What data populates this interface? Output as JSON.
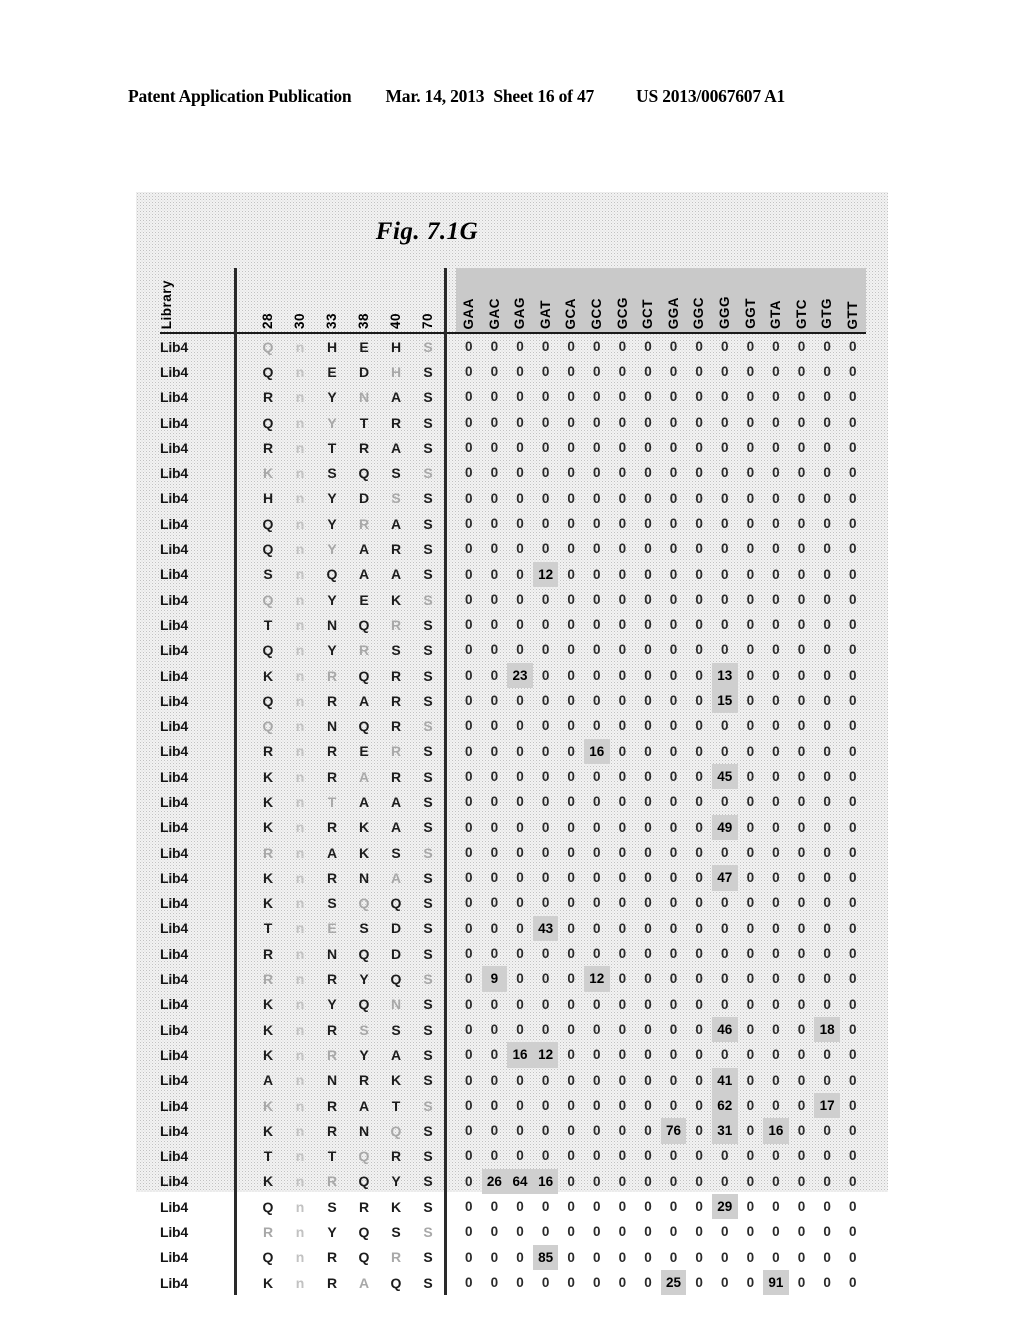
{
  "header": {
    "publication": "Patent Application Publication",
    "date": "Mar. 14, 2013",
    "sheet": "Sheet 16 of 47",
    "patent_number": "US 2013/0067607 A1"
  },
  "figure": {
    "title": "Fig. 7.1G"
  },
  "table": {
    "library_header": "Library",
    "position_headers": [
      "28",
      "30",
      "33",
      "38",
      "40",
      "70"
    ],
    "codon_headers": [
      "GAA",
      "GAC",
      "GAG",
      "GAT",
      "GCA",
      "GCC",
      "GCG",
      "GCT",
      "GGA",
      "GGC",
      "GGG",
      "GGT",
      "GTA",
      "GTC",
      "GTG",
      "GTT"
    ],
    "rows": [
      {
        "library": "Lib4",
        "residues": [
          "Q",
          "n",
          "H",
          "E",
          "H",
          "S"
        ],
        "values": [
          0,
          0,
          0,
          0,
          0,
          0,
          0,
          0,
          0,
          0,
          0,
          0,
          0,
          0,
          0,
          0
        ]
      },
      {
        "library": "Lib4",
        "residues": [
          "Q",
          "n",
          "E",
          "D",
          "H",
          "S"
        ],
        "values": [
          0,
          0,
          0,
          0,
          0,
          0,
          0,
          0,
          0,
          0,
          0,
          0,
          0,
          0,
          0,
          0
        ]
      },
      {
        "library": "Lib4",
        "residues": [
          "R",
          "n",
          "Y",
          "N",
          "A",
          "S"
        ],
        "values": [
          0,
          0,
          0,
          0,
          0,
          0,
          0,
          0,
          0,
          0,
          0,
          0,
          0,
          0,
          0,
          0
        ]
      },
      {
        "library": "Lib4",
        "residues": [
          "Q",
          "n",
          "Y",
          "T",
          "R",
          "S"
        ],
        "values": [
          0,
          0,
          0,
          0,
          0,
          0,
          0,
          0,
          0,
          0,
          0,
          0,
          0,
          0,
          0,
          0
        ]
      },
      {
        "library": "Lib4",
        "residues": [
          "R",
          "n",
          "T",
          "R",
          "A",
          "S"
        ],
        "values": [
          0,
          0,
          0,
          0,
          0,
          0,
          0,
          0,
          0,
          0,
          0,
          0,
          0,
          0,
          0,
          0
        ]
      },
      {
        "library": "Lib4",
        "residues": [
          "K",
          "n",
          "S",
          "Q",
          "S",
          "S"
        ],
        "values": [
          0,
          0,
          0,
          0,
          0,
          0,
          0,
          0,
          0,
          0,
          0,
          0,
          0,
          0,
          0,
          0
        ]
      },
      {
        "library": "Lib4",
        "residues": [
          "H",
          "n",
          "Y",
          "D",
          "S",
          "S"
        ],
        "values": [
          0,
          0,
          0,
          0,
          0,
          0,
          0,
          0,
          0,
          0,
          0,
          0,
          0,
          0,
          0,
          0
        ]
      },
      {
        "library": "Lib4",
        "residues": [
          "Q",
          "n",
          "Y",
          "R",
          "A",
          "S"
        ],
        "values": [
          0,
          0,
          0,
          0,
          0,
          0,
          0,
          0,
          0,
          0,
          0,
          0,
          0,
          0,
          0,
          0
        ]
      },
      {
        "library": "Lib4",
        "residues": [
          "Q",
          "n",
          "Y",
          "A",
          "R",
          "S"
        ],
        "values": [
          0,
          0,
          0,
          0,
          0,
          0,
          0,
          0,
          0,
          0,
          0,
          0,
          0,
          0,
          0,
          0
        ]
      },
      {
        "library": "Lib4",
        "residues": [
          "S",
          "n",
          "Q",
          "A",
          "A",
          "S"
        ],
        "values": [
          0,
          0,
          0,
          12,
          0,
          0,
          0,
          0,
          0,
          0,
          0,
          0,
          0,
          0,
          0,
          0
        ]
      },
      {
        "library": "Lib4",
        "residues": [
          "Q",
          "n",
          "Y",
          "E",
          "K",
          "S"
        ],
        "values": [
          0,
          0,
          0,
          0,
          0,
          0,
          0,
          0,
          0,
          0,
          0,
          0,
          0,
          0,
          0,
          0
        ]
      },
      {
        "library": "Lib4",
        "residues": [
          "T",
          "n",
          "N",
          "Q",
          "R",
          "S"
        ],
        "values": [
          0,
          0,
          0,
          0,
          0,
          0,
          0,
          0,
          0,
          0,
          0,
          0,
          0,
          0,
          0,
          0
        ]
      },
      {
        "library": "Lib4",
        "residues": [
          "Q",
          "n",
          "Y",
          "R",
          "S",
          "S"
        ],
        "values": [
          0,
          0,
          0,
          0,
          0,
          0,
          0,
          0,
          0,
          0,
          0,
          0,
          0,
          0,
          0,
          0
        ]
      },
      {
        "library": "Lib4",
        "residues": [
          "K",
          "n",
          "R",
          "Q",
          "R",
          "S"
        ],
        "values": [
          0,
          0,
          23,
          0,
          0,
          0,
          0,
          0,
          0,
          0,
          13,
          0,
          0,
          0,
          0,
          0
        ]
      },
      {
        "library": "Lib4",
        "residues": [
          "Q",
          "n",
          "R",
          "A",
          "R",
          "S"
        ],
        "values": [
          0,
          0,
          0,
          0,
          0,
          0,
          0,
          0,
          0,
          0,
          15,
          0,
          0,
          0,
          0,
          0
        ]
      },
      {
        "library": "Lib4",
        "residues": [
          "Q",
          "n",
          "N",
          "Q",
          "R",
          "S"
        ],
        "values": [
          0,
          0,
          0,
          0,
          0,
          0,
          0,
          0,
          0,
          0,
          0,
          0,
          0,
          0,
          0,
          0
        ]
      },
      {
        "library": "Lib4",
        "residues": [
          "R",
          "n",
          "R",
          "E",
          "R",
          "S"
        ],
        "values": [
          0,
          0,
          0,
          0,
          0,
          16,
          0,
          0,
          0,
          0,
          0,
          0,
          0,
          0,
          0,
          0
        ]
      },
      {
        "library": "Lib4",
        "residues": [
          "K",
          "n",
          "R",
          "A",
          "R",
          "S"
        ],
        "values": [
          0,
          0,
          0,
          0,
          0,
          0,
          0,
          0,
          0,
          0,
          45,
          0,
          0,
          0,
          0,
          0
        ]
      },
      {
        "library": "Lib4",
        "residues": [
          "K",
          "n",
          "T",
          "A",
          "A",
          "S"
        ],
        "values": [
          0,
          0,
          0,
          0,
          0,
          0,
          0,
          0,
          0,
          0,
          0,
          0,
          0,
          0,
          0,
          0
        ]
      },
      {
        "library": "Lib4",
        "residues": [
          "K",
          "n",
          "R",
          "K",
          "A",
          "S"
        ],
        "values": [
          0,
          0,
          0,
          0,
          0,
          0,
          0,
          0,
          0,
          0,
          49,
          0,
          0,
          0,
          0,
          0
        ]
      },
      {
        "library": "Lib4",
        "residues": [
          "R",
          "n",
          "A",
          "K",
          "S",
          "S"
        ],
        "values": [
          0,
          0,
          0,
          0,
          0,
          0,
          0,
          0,
          0,
          0,
          0,
          0,
          0,
          0,
          0,
          0
        ]
      },
      {
        "library": "Lib4",
        "residues": [
          "K",
          "n",
          "R",
          "N",
          "A",
          "S"
        ],
        "values": [
          0,
          0,
          0,
          0,
          0,
          0,
          0,
          0,
          0,
          0,
          47,
          0,
          0,
          0,
          0,
          0
        ]
      },
      {
        "library": "Lib4",
        "residues": [
          "K",
          "n",
          "S",
          "Q",
          "Q",
          "S"
        ],
        "values": [
          0,
          0,
          0,
          0,
          0,
          0,
          0,
          0,
          0,
          0,
          0,
          0,
          0,
          0,
          0,
          0
        ]
      },
      {
        "library": "Lib4",
        "residues": [
          "T",
          "n",
          "E",
          "S",
          "D",
          "S"
        ],
        "values": [
          0,
          0,
          0,
          43,
          0,
          0,
          0,
          0,
          0,
          0,
          0,
          0,
          0,
          0,
          0,
          0
        ]
      },
      {
        "library": "Lib4",
        "residues": [
          "R",
          "n",
          "N",
          "Q",
          "D",
          "S"
        ],
        "values": [
          0,
          0,
          0,
          0,
          0,
          0,
          0,
          0,
          0,
          0,
          0,
          0,
          0,
          0,
          0,
          0
        ]
      },
      {
        "library": "Lib4",
        "residues": [
          "R",
          "n",
          "R",
          "Y",
          "Q",
          "S"
        ],
        "values": [
          0,
          9,
          0,
          0,
          0,
          12,
          0,
          0,
          0,
          0,
          0,
          0,
          0,
          0,
          0,
          0
        ]
      },
      {
        "library": "Lib4",
        "residues": [
          "K",
          "n",
          "Y",
          "Q",
          "N",
          "S"
        ],
        "values": [
          0,
          0,
          0,
          0,
          0,
          0,
          0,
          0,
          0,
          0,
          0,
          0,
          0,
          0,
          0,
          0
        ]
      },
      {
        "library": "Lib4",
        "residues": [
          "K",
          "n",
          "R",
          "S",
          "S",
          "S"
        ],
        "values": [
          0,
          0,
          0,
          0,
          0,
          0,
          0,
          0,
          0,
          0,
          46,
          0,
          0,
          0,
          18,
          0
        ]
      },
      {
        "library": "Lib4",
        "residues": [
          "K",
          "n",
          "R",
          "Y",
          "A",
          "S"
        ],
        "values": [
          0,
          0,
          16,
          12,
          0,
          0,
          0,
          0,
          0,
          0,
          0,
          0,
          0,
          0,
          0,
          0
        ]
      },
      {
        "library": "Lib4",
        "residues": [
          "A",
          "n",
          "N",
          "R",
          "K",
          "S"
        ],
        "values": [
          0,
          0,
          0,
          0,
          0,
          0,
          0,
          0,
          0,
          0,
          41,
          0,
          0,
          0,
          0,
          0
        ]
      },
      {
        "library": "Lib4",
        "residues": [
          "K",
          "n",
          "R",
          "A",
          "T",
          "S"
        ],
        "values": [
          0,
          0,
          0,
          0,
          0,
          0,
          0,
          0,
          0,
          0,
          62,
          0,
          0,
          0,
          17,
          0
        ]
      },
      {
        "library": "Lib4",
        "residues": [
          "K",
          "n",
          "R",
          "N",
          "Q",
          "S"
        ],
        "values": [
          0,
          0,
          0,
          0,
          0,
          0,
          0,
          0,
          76,
          0,
          31,
          0,
          16,
          0,
          0,
          0
        ]
      },
      {
        "library": "Lib4",
        "residues": [
          "T",
          "n",
          "T",
          "Q",
          "R",
          "S"
        ],
        "values": [
          0,
          0,
          0,
          0,
          0,
          0,
          0,
          0,
          0,
          0,
          0,
          0,
          0,
          0,
          0,
          0
        ]
      },
      {
        "library": "Lib4",
        "residues": [
          "K",
          "n",
          "R",
          "Q",
          "Y",
          "S"
        ],
        "values": [
          0,
          26,
          64,
          16,
          0,
          0,
          0,
          0,
          0,
          0,
          0,
          0,
          0,
          0,
          0,
          0
        ]
      },
      {
        "library": "Lib4",
        "residues": [
          "Q",
          "n",
          "S",
          "R",
          "K",
          "S"
        ],
        "values": [
          0,
          0,
          0,
          0,
          0,
          0,
          0,
          0,
          0,
          0,
          29,
          0,
          0,
          0,
          0,
          0
        ]
      },
      {
        "library": "Lib4",
        "residues": [
          "R",
          "n",
          "Y",
          "Q",
          "S",
          "S"
        ],
        "values": [
          0,
          0,
          0,
          0,
          0,
          0,
          0,
          0,
          0,
          0,
          0,
          0,
          0,
          0,
          0,
          0
        ]
      },
      {
        "library": "Lib4",
        "residues": [
          "Q",
          "n",
          "R",
          "Q",
          "R",
          "S"
        ],
        "values": [
          0,
          0,
          0,
          85,
          0,
          0,
          0,
          0,
          0,
          0,
          0,
          0,
          0,
          0,
          0,
          0
        ]
      },
      {
        "library": "Lib4",
        "residues": [
          "K",
          "n",
          "R",
          "A",
          "Q",
          "S"
        ],
        "values": [
          0,
          0,
          0,
          0,
          0,
          0,
          0,
          0,
          25,
          0,
          0,
          0,
          91,
          0,
          0,
          0
        ]
      }
    ]
  }
}
